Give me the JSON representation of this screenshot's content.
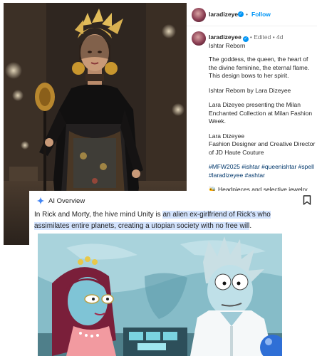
{
  "post": {
    "username": "laradizeyee",
    "follow_label": "Follow",
    "separator": "•",
    "edited_label": "Edited",
    "age": "4d",
    "title": "Ishtar Reborn",
    "paragraphs": [
      "The goddess, the queen, the heart of the divine feminine, the eternal flame. This design bows to her spirit.",
      "Ishtar Reborn by Lara Dizeyee",
      "Lara Dizeyee presenting the Milan Enchanted Collection at Milan Fashion Week.",
      "Lara Dizeyee\nFashion Designer and Creative Director of JD Haute Couture"
    ],
    "hashtags": "#MFW2025 #ishtar #queenishtar #spell #laradizeyee #ashtar",
    "credits_emoji": "🐝",
    "credits": "Headpieces and selective jewelry crafted by  Muna Darman"
  },
  "ai_overview": {
    "title": "AI Overview",
    "text_before": "In Rick and Morty, the hive mind Unity is ",
    "text_highlight": "an alien ex-girlfriend of Rick's who assimilates entire planets, creating a utopian society with no free will",
    "text_after": ".",
    "colors": {
      "highlight": "#d3e3fd",
      "accent": "#4285f4"
    }
  },
  "icons": [
    "verified-badge-icon",
    "ai-sparkle-icon",
    "bookmark-icon"
  ]
}
